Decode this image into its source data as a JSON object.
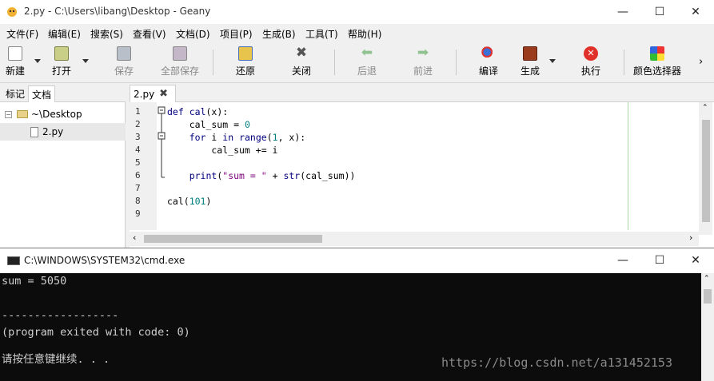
{
  "geany": {
    "title": "2.py - C:\\Users\\libang\\Desktop - Geany",
    "menu": [
      "文件(F)",
      "编辑(E)",
      "搜索(S)",
      "查看(V)",
      "文档(D)",
      "项目(P)",
      "生成(B)",
      "工具(T)",
      "帮助(H)"
    ],
    "toolbar": {
      "new": "新建",
      "open": "打开",
      "save": "保存",
      "save_all": "全部保存",
      "revert": "还原",
      "close": "关闭",
      "back": "后退",
      "forward": "前进",
      "compile": "编译",
      "build": "生成",
      "execute": "执行",
      "color_picker": "颜色选择器"
    },
    "sidebar": {
      "tabs": [
        "标记",
        "文档"
      ],
      "active_tab": "文档",
      "folder": "~\\Desktop",
      "file": "2.py"
    },
    "editor": {
      "tab_label": "2.py",
      "line_numbers": [
        "1",
        "2",
        "3",
        "4",
        "5",
        "6",
        "7",
        "8",
        "9"
      ]
    }
  },
  "cmd": {
    "title": "C:\\WINDOWS\\SYSTEM32\\cmd.exe",
    "lines": [
      "sum = 5050",
      "",
      "------------------",
      "(program exited with code: 0)",
      "",
      "请按任意键继续. . ."
    ],
    "watermark": "https://blog.csdn.net/a131452153"
  },
  "icons": {
    "minimize": "minimize-icon",
    "maximize": "maximize-icon",
    "close": "close-icon"
  }
}
